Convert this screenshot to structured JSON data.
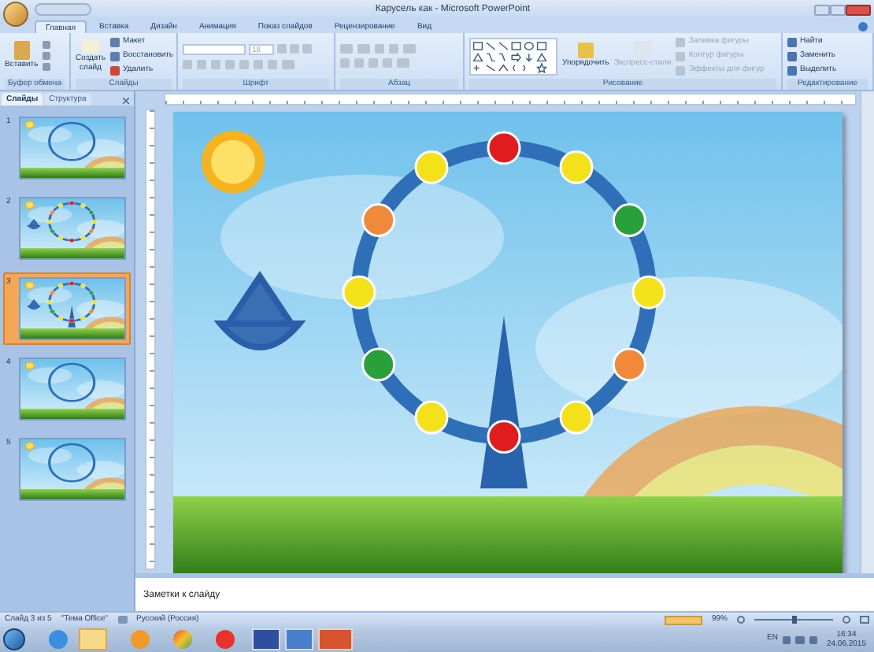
{
  "window": {
    "title": "Карусель как - Microsoft PowerPoint"
  },
  "ribbon_tabs": [
    {
      "label": "Главная",
      "selected": true
    },
    {
      "label": "Вставка",
      "selected": false
    },
    {
      "label": "Дизайн",
      "selected": false
    },
    {
      "label": "Анимация",
      "selected": false
    },
    {
      "label": "Показ слайдов",
      "selected": false
    },
    {
      "label": "Рецензирование",
      "selected": false
    },
    {
      "label": "Вид",
      "selected": false
    }
  ],
  "clipboard": {
    "title": "Буфер обмена",
    "paste": "Вставить"
  },
  "slides_group": {
    "title": "Слайды",
    "new_slide": "Создать слайд",
    "commands": [
      {
        "label": "Макет",
        "disabled": false
      },
      {
        "label": "Восстановить",
        "disabled": false
      },
      {
        "label": "Удалить",
        "disabled": false
      }
    ]
  },
  "font": {
    "title": "Шрифт",
    "size": "18"
  },
  "paragraph": {
    "title": "Абзац"
  },
  "drawing": {
    "title": "Рисование",
    "arrange": "Упорядочить",
    "quick_styles": {
      "label": "Экспресс-стили",
      "disabled": true
    },
    "commands": [
      {
        "label": "Заливка фигуры",
        "disabled": true
      },
      {
        "label": "Контур фигуры",
        "disabled": true
      },
      {
        "label": "Эффекты для фигур",
        "disabled": true
      }
    ]
  },
  "editing": {
    "title": "Редактирование",
    "commands": [
      {
        "label": "Найти",
        "disabled": false
      },
      {
        "label": "Заменить",
        "disabled": false
      },
      {
        "label": "Выделить",
        "disabled": false
      }
    ]
  },
  "panel_tabs": [
    {
      "label": "Слайды",
      "selected": true
    },
    {
      "label": "Структура",
      "selected": false
    }
  ],
  "slides": [
    {
      "number": "1",
      "selected": false
    },
    {
      "number": "2",
      "selected": false
    },
    {
      "number": "3",
      "selected": true
    },
    {
      "number": "4",
      "selected": false
    },
    {
      "number": "5",
      "selected": false
    }
  ],
  "notes": {
    "placeholder": "Заметки к слайду"
  },
  "status_bar": {
    "slide": "Слайд 3 из 5",
    "theme": "\"Тема Office\"",
    "language": "Русский (Россия)",
    "zoom": "99%",
    "zoom_slider": {
      "level": 0.5
    }
  },
  "taskbar": {
    "language": "EN",
    "time": "16:34",
    "date": "24.06.2015"
  }
}
